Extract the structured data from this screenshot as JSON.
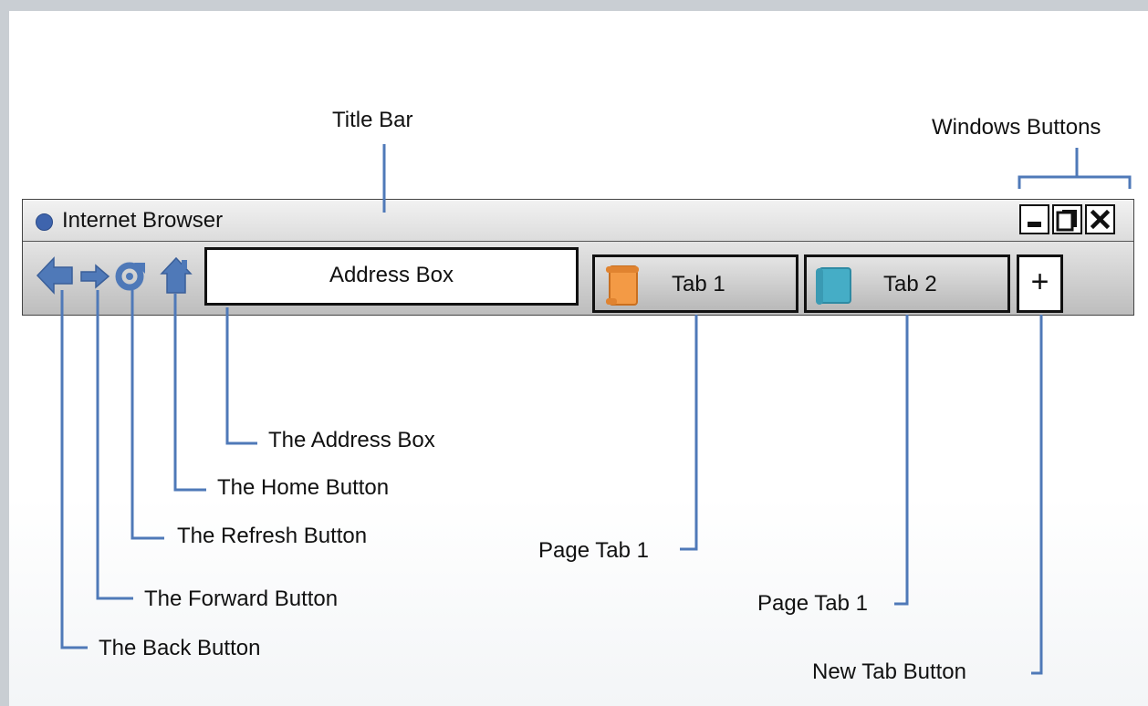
{
  "labels": {
    "title_bar": "Title Bar",
    "windows_buttons": "Windows Buttons",
    "address_box_callout": "The Address Box",
    "home_button": "The Home Button",
    "refresh_button": "The Refresh Button",
    "forward_button": "The Forward Button",
    "back_button": "The Back Button",
    "page_tab_1": "Page Tab 1",
    "page_tab_2": "Page Tab 1",
    "new_tab_button": "New Tab Button"
  },
  "browser": {
    "title": "Internet Browser",
    "address_box": "Address Box",
    "tabs": [
      {
        "label": "Tab 1",
        "icon": "orange-page-icon",
        "color": "#f39a45"
      },
      {
        "label": "Tab 2",
        "icon": "teal-page-icon",
        "color": "#45adc6"
      }
    ],
    "new_tab": "+"
  },
  "colors": {
    "callout": "#4f79b8",
    "nav_icon": "#4f79b8"
  }
}
